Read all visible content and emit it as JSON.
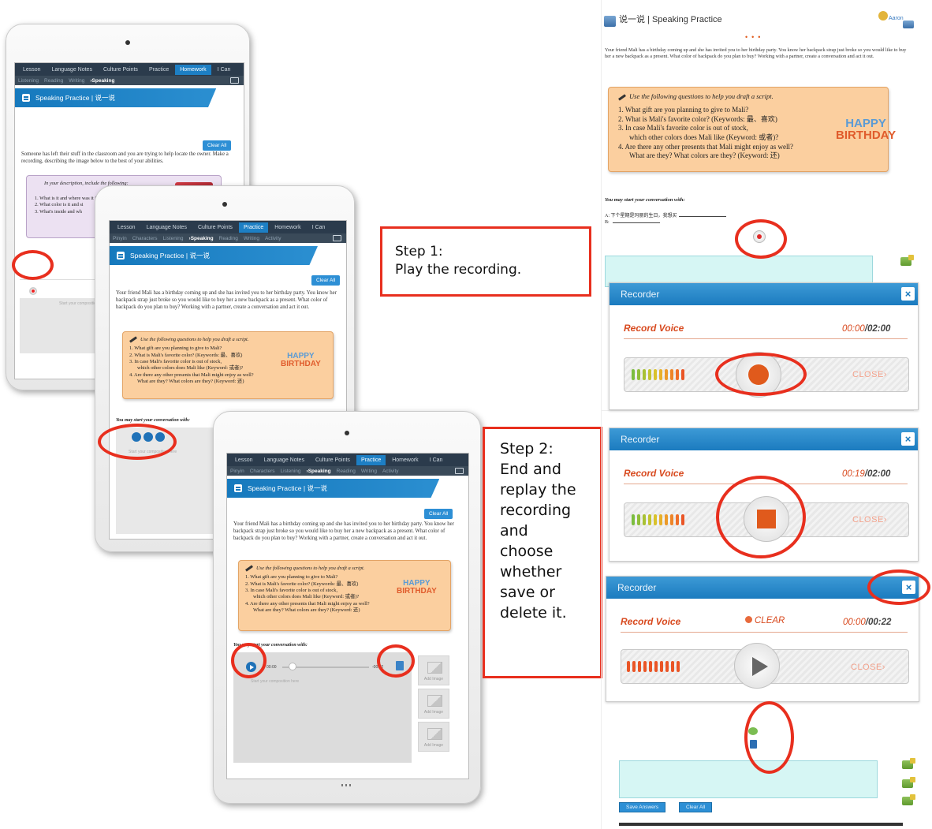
{
  "tablet1": {
    "nav_tabs": [
      "Lesson",
      "Language Notes",
      "Culture Points",
      "Practice",
      "Homework",
      "I Can"
    ],
    "active_tab": "Homework",
    "sub_tabs": [
      "Listening",
      "Reading",
      "Writing"
    ],
    "current_sub": "Speaking",
    "banner_title": "Speaking Practice | 说一说",
    "clear_all": "Clear All",
    "instructions": "Someone has left their stuff in the classroom and you are trying to help locate the owner. Make a recording, describing the image below to the best of your abilities.",
    "box_header": "In your description, include the following:",
    "box_lines": [
      "1. What is it and where was it found?",
      "2. What color is it and si",
      "3. What's inside and wh"
    ],
    "placeholder": "Start your composition"
  },
  "tablet2": {
    "nav_tabs": [
      "Lesson",
      "Language Notes",
      "Culture Points",
      "Practice",
      "Homework",
      "I Can"
    ],
    "active_tab": "Practice",
    "sub_tabs": [
      "Pinyin",
      "Characters",
      "Listening"
    ],
    "current_sub": "Speaking",
    "sub_tabs_after": [
      "Reading",
      "Writing",
      "Activity"
    ],
    "banner_title": "Speaking Practice | 说一说",
    "clear_all": "Clear All",
    "scenario": "Your friend Mali has a birthday coming up and she has invited you to her birthday party. You know her backpack strap just broke so you would like to buy her a new backpack as a present. What color of backpack do you plan to buy? Working with a partner, create a conversation and act it out.",
    "box_header": "Use the following questions to help you draft a script.",
    "questions": [
      "1. What gift are you planning to give to Mali?",
      "2. What is Mali's favorite color? (Keywords: 最、喜欢)",
      "3. In case Mali's favorite color is out of stock,",
      "which other colors does Mali like (Keyword: 或者)?",
      "4. Are there any other presents that Mali might enjoy as well?",
      "What are they? What colors are they? (Keyword: 还)"
    ],
    "prompt": "You may start your conversation with:",
    "placeholder": "Start your composition here"
  },
  "tablet3": {
    "nav_tabs": [
      "Lesson",
      "Language Notes",
      "Culture Points",
      "Practice",
      "Homework",
      "I Can"
    ],
    "active_tab": "Practice",
    "sub_tabs": [
      "Pinyin",
      "Characters",
      "Listening"
    ],
    "current_sub": "Speaking",
    "sub_tabs_after": [
      "Reading",
      "Writing",
      "Activity"
    ],
    "banner_title": "Speaking Practice | 说一说",
    "clear_all": "Clear All",
    "scenario": "Your friend Mali has a birthday coming up and she has invited you to her birthday party. You know her backpack strap just broke so you would like to buy her a new backpack as a present. What color of backpack do you plan to buy? Working with a partner, create a conversation and act it out.",
    "box_header": "Use the following questions to help you draft a script.",
    "questions": [
      "1. What gift are you planning to give to Mali?",
      "2. What is Mali's favorite color? (Keywords: 最、喜欢)",
      "3. In case Mali's favorite color is out of stock,",
      "which other colors does Mali like (Keyword: 或者)?",
      "4. Are there any other presents that Mali might enjoy as well?",
      "What are they? What colors are they? (Keyword: 还)"
    ],
    "prompt": "You may start your conversation with:",
    "time_start": "00:00",
    "time_end": "-00:22",
    "placeholder": "Start your composition here",
    "add_image": "Add Image"
  },
  "happy_birthday": {
    "happy": "HAPPY",
    "birthday": "BIRTHDAY"
  },
  "step1": {
    "line1": "Step 1:",
    "line2": "Play the recording."
  },
  "step2": {
    "lines": [
      "Step 2:",
      "End and",
      "replay the",
      "recording",
      "and",
      "choose",
      "whether",
      "save or",
      "delete it."
    ]
  },
  "page": {
    "title": "说一说 | Speaking Practice",
    "user": "Aaron",
    "scenario": "Your friend Mali has a birthday coming up and she has invited you to her birthday party. You know her backpack strap just broke so you would like to buy her a new backpack as a present. What color of backpack do you plan to buy? Working with a partner, create a conversation and act it out.",
    "box_header": "Use the following questions to help you draft a script.",
    "questions": [
      "1. What gift are you planning to give to Mali?",
      "2. What is Mali's favorite color? (Keywords: 最、喜欢)",
      "3. In case Mali's favorite color is out of stock,",
      "which other colors does Mali like (Keyword: 或者)?",
      "4. Are there any other presents that Mali might enjoy as well?",
      "What are they? What colors are they? (Keyword: 还)"
    ],
    "prompt": "You may start your conversation with:",
    "line_a": "A: 下个星期是玛丽的生日，我想买",
    "line_b": "B:"
  },
  "recorders": [
    {
      "title": "Recorder",
      "label": "Record Voice",
      "elapsed": "00:00",
      "total": "/02:00",
      "close": "CLOSE›"
    },
    {
      "title": "Recorder",
      "label": "Record Voice",
      "elapsed": "00:19",
      "total": "/02:00",
      "close": "CLOSE›"
    },
    {
      "title": "Recorder",
      "label": "Record Voice",
      "clear": "CLEAR",
      "elapsed": "00:00",
      "total": "/00:22",
      "close": "CLOSE›"
    }
  ],
  "bottom": {
    "save": "Save Answers",
    "clear": "Clear All"
  },
  "colors": {
    "accent": "#1b7bbf",
    "highlight": "#e82f1e",
    "record": "#e05a1c"
  }
}
